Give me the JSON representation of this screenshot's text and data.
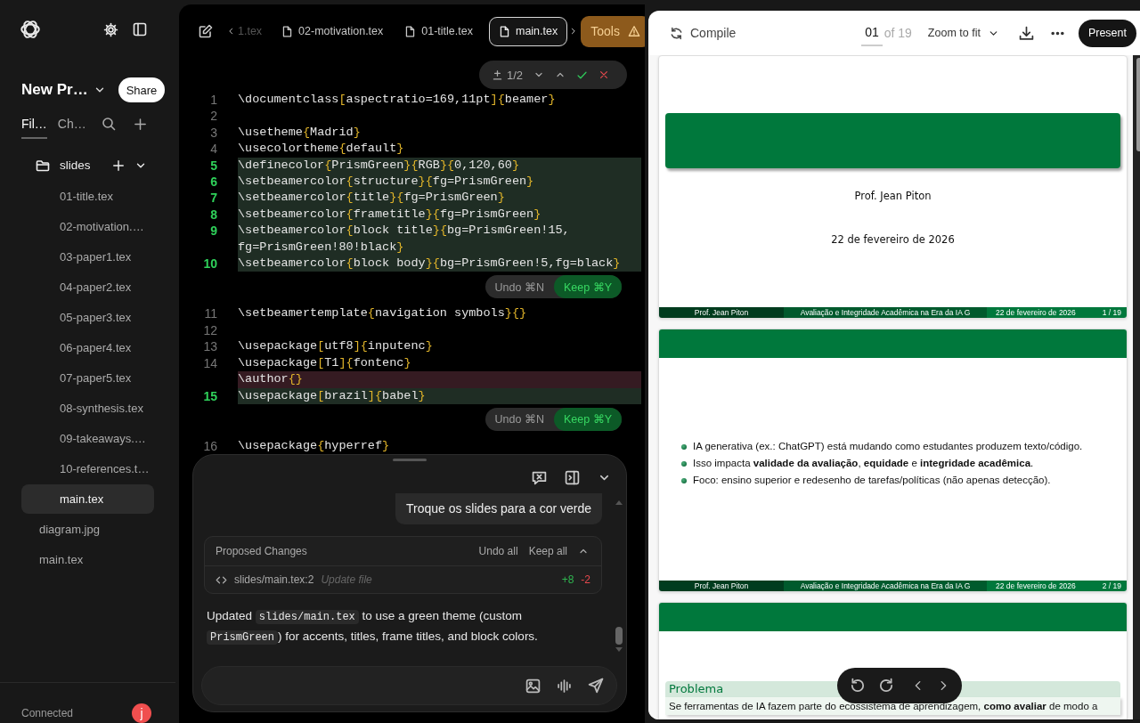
{
  "sidebar": {
    "project_name": "New Pr…",
    "share_label": "Share",
    "tabs": [
      {
        "label": "Fil…",
        "selected": true
      },
      {
        "label": "Ch…",
        "selected": false
      }
    ],
    "tree": [
      {
        "label": "slides",
        "kind": "folder",
        "expanded": true,
        "children": [
          {
            "label": "01-title.tex",
            "kind": "file",
            "selected": false
          },
          {
            "label": "02-motivation.…",
            "kind": "file",
            "selected": false
          },
          {
            "label": "03-paper1.tex",
            "kind": "file",
            "selected": false
          },
          {
            "label": "04-paper2.tex",
            "kind": "file",
            "selected": false
          },
          {
            "label": "05-paper3.tex",
            "kind": "file",
            "selected": false
          },
          {
            "label": "06-paper4.tex",
            "kind": "file",
            "selected": false
          },
          {
            "label": "07-paper5.tex",
            "kind": "file",
            "selected": false
          },
          {
            "label": "08-synthesis.tex",
            "kind": "file",
            "selected": false
          },
          {
            "label": "09-takeaways.…",
            "kind": "file",
            "selected": false
          },
          {
            "label": "10-references.t…",
            "kind": "file",
            "selected": false
          },
          {
            "label": "main.tex",
            "kind": "file",
            "selected": true
          }
        ]
      },
      {
        "label": "diagram.jpg",
        "kind": "file",
        "selected": false
      },
      {
        "label": "main.tex",
        "kind": "file",
        "selected": false
      }
    ],
    "status": "Connected",
    "avatar_letter": "j"
  },
  "editor": {
    "tabs": [
      {
        "label": "1.tex",
        "kind": "clipped",
        "selected": false
      },
      {
        "label": "02-motivation.tex",
        "kind": "file",
        "selected": false
      },
      {
        "label": "01-title.tex",
        "kind": "file",
        "selected": false
      },
      {
        "label": "main.tex",
        "kind": "file",
        "selected": true
      }
    ],
    "tools_label": "Tools",
    "diff_counter": "1/2",
    "lines": [
      {
        "kind": "line",
        "number": "1",
        "text": "\\documentclass[aspectratio=169,11pt]{beamer}"
      },
      {
        "kind": "line",
        "number": "2"
      },
      {
        "kind": "line",
        "number": "3",
        "text": "\\usetheme{Madrid}"
      },
      {
        "kind": "line",
        "number": "4",
        "text": "\\usecolortheme{default}"
      },
      {
        "kind": "added",
        "number": "5",
        "text": "\\definecolor{PrismGreen}{RGB}{0,120,60}"
      },
      {
        "kind": "added",
        "number": "6",
        "text": "\\setbeamercolor{structure}{fg=PrismGreen}"
      },
      {
        "kind": "added",
        "number": "7",
        "text": "\\setbeamercolor{title}{fg=PrismGreen}"
      },
      {
        "kind": "added",
        "number": "8",
        "text": "\\setbeamercolor{frametitle}{fg=PrismGreen}"
      },
      {
        "kind": "added",
        "number": "9",
        "text": "\\setbeamercolor{block title}{bg=PrismGreen!15,fg=PrismGreen!80!black}"
      },
      {
        "kind": "added",
        "number": "10",
        "text": "\\setbeamercolor{block body}{bg=PrismGreen!5,fg=black}"
      },
      {
        "kind": "actions",
        "undo": "Undo ⌘N",
        "keep": "Keep ⌘Y"
      },
      {
        "kind": "line",
        "number": "11",
        "text": "\\setbeamertemplate{navigation symbols}{}"
      },
      {
        "kind": "line",
        "number": "12"
      },
      {
        "kind": "line",
        "number": "13",
        "text": "\\usepackage[utf8]{inputenc}"
      },
      {
        "kind": "line",
        "number": "14",
        "text": "\\usepackage[T1]{fontenc}"
      },
      {
        "kind": "removed",
        "text": "\\author{}"
      },
      {
        "kind": "added",
        "number": "15",
        "text": "\\usepackage[brazil]{babel}"
      },
      {
        "kind": "actions",
        "undo": "Undo ⌘N",
        "keep": "Keep ⌘Y"
      },
      {
        "kind": "line",
        "number": "16",
        "text": "\\usepackage{hyperref}"
      }
    ]
  },
  "chat": {
    "user_message": "Troque os slides para a cor verde",
    "changes": {
      "title": "Proposed Changes",
      "undo_all": "Undo all",
      "keep_all": "Keep all",
      "expanded": true,
      "files": [
        {
          "path": "slides/main.tex:2",
          "action": "Update file",
          "added": "+8",
          "removed": "-2"
        }
      ]
    },
    "reply": [
      {
        "kind": "text",
        "text": "Updated "
      },
      {
        "kind": "code",
        "text": "slides/main.tex"
      },
      {
        "kind": "text",
        "text": " to use a green theme (custom "
      },
      {
        "kind": "code",
        "text": "PrismGreen"
      },
      {
        "kind": "text",
        "text": ") for accents, titles, frame titles, and block colors."
      }
    ]
  },
  "preview": {
    "compile_label": "Compile",
    "page": "01",
    "page_count": "of 19",
    "zoom": "Zoom to fit",
    "present_label": "Present",
    "slides": [
      {
        "kind": "title",
        "author": "Prof. Jean Piton",
        "date": "22 de fevereiro de 2026",
        "footer": [
          "Prof. Jean Piton",
          "Avaliação e Integridade Acadêmica na Era da IA G",
          "22 de fevereiro de 2026",
          "1 / 19"
        ]
      },
      {
        "kind": "bullets",
        "bullets": [
          "IA generativa (ex.: ChatGPT) está mudando como estudantes produzem texto/código.",
          "Isso impacta **validade da avaliação**, **equidade** e **integridade acadêmica**.",
          "Foco: ensino superior e redesenho de tarefas/políticas (não apenas detecção)."
        ],
        "footer": [
          "Prof. Jean Piton",
          "Avaliação e Integridade Acadêmica na Era da IA G",
          "22 de fevereiro de 2026",
          "2 / 19"
        ]
      },
      {
        "kind": "block",
        "block_title": "Problema",
        "block_text": "Se ferramentas de IA fazem parte do ecossistema de aprendizagem, **como avaliar** de modo a"
      }
    ]
  }
}
